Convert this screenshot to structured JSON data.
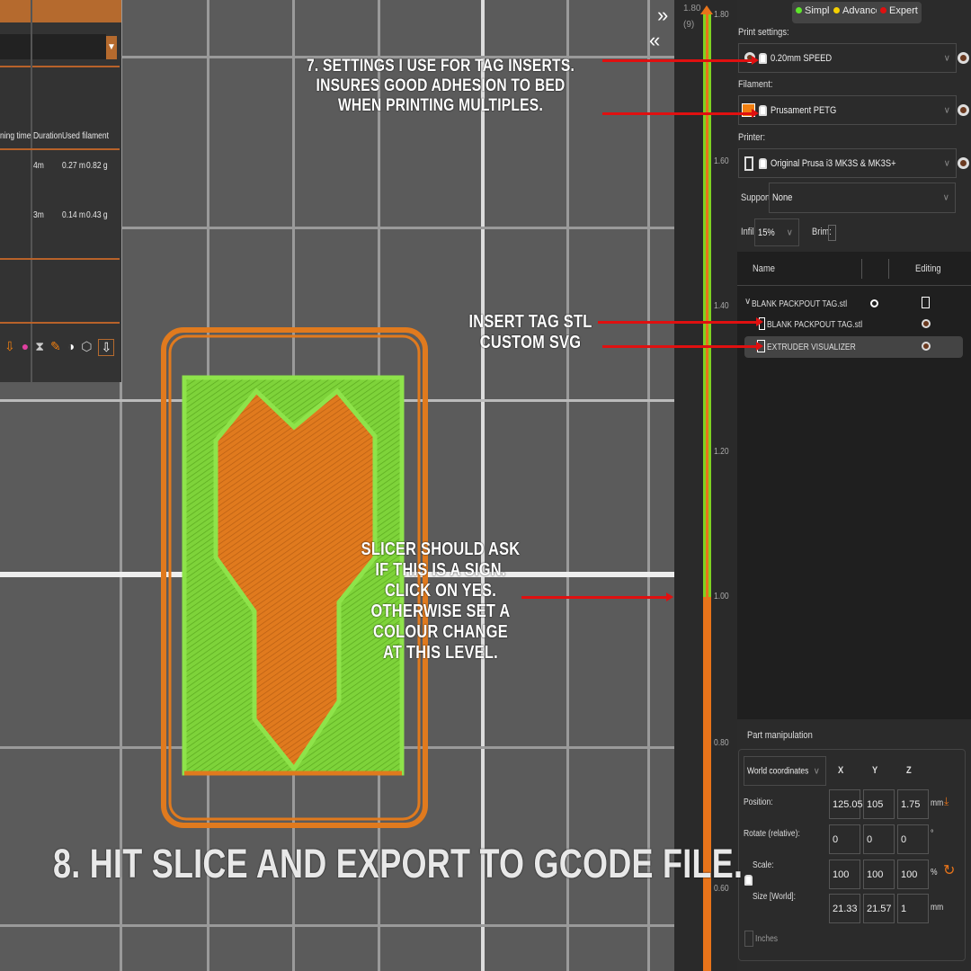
{
  "left_panel": {
    "columns": [
      "ning time",
      "Duration",
      "Used filament"
    ],
    "rows": [
      {
        "duration": "4m",
        "length": "0.27 m",
        "weight": "0.82 g"
      },
      {
        "duration": "3m",
        "length": "0.14 m",
        "weight": "0.43 g"
      }
    ],
    "toolbar_icons": [
      "extruder-icon",
      "color-icon",
      "hourglass-icon",
      "tool-change-icon",
      "center-icon",
      "wipe-tower-icon",
      "extruder-selected-icon"
    ]
  },
  "slider": {
    "top_label": "1.80",
    "top_layer": "(9)",
    "ticks": [
      "1.80",
      "1.60",
      "1.40",
      "1.20",
      "1.00",
      "0.80",
      "0.60"
    ],
    "colors": {
      "upper": "#7ed321",
      "lower": "#e8741a"
    }
  },
  "modes": [
    {
      "label": "Simple",
      "color": "#5ee62b"
    },
    {
      "label": "Advanced",
      "color": "#f5d000"
    },
    {
      "label": "Expert",
      "color": "#e01010"
    }
  ],
  "print_settings": {
    "label": "Print settings:",
    "value": "0.20mm SPEED"
  },
  "filament": {
    "label": "Filament:",
    "value": "Prusament PETG",
    "color": "#f07f10"
  },
  "printer": {
    "label": "Printer:",
    "value": "Original Prusa i3 MK3S & MK3S+"
  },
  "supports": {
    "label": "Supports:",
    "value": "None"
  },
  "infill": {
    "label": "Infill:",
    "value": "15%"
  },
  "brim": {
    "label": "Brim:"
  },
  "object_list": {
    "headers": [
      "Name",
      "Editing"
    ],
    "items": [
      {
        "name": "BLANK  PACKPOUT TAG.stl"
      },
      {
        "name": "BLANK  PACKPOUT TAG.stl"
      },
      {
        "name": "EXTRUDER VISUALIZER"
      }
    ]
  },
  "part_manipulation": {
    "title": "Part manipulation",
    "coords": "World coordinates",
    "axes": [
      "X",
      "Y",
      "Z"
    ],
    "position": {
      "label": "Position:",
      "values": [
        "125.05",
        "105",
        "1.75"
      ],
      "unit": "mm"
    },
    "rotate": {
      "label": "Rotate (relative):",
      "values": [
        "0",
        "0",
        "0"
      ],
      "unit": "°"
    },
    "scale": {
      "label": "Scale:",
      "values": [
        "100",
        "100",
        "100"
      ],
      "unit": "%"
    },
    "size": {
      "label": "Size [World]:",
      "values": [
        "21.33",
        "21.57",
        "1"
      ],
      "unit": "mm"
    },
    "inches": "Inches"
  },
  "annotations": {
    "settings": "7. SETTINGS I USE FOR TAG INSERTS.\nINSURES GOOD ADHESION TO BED\nWHEN PRINTING MULTIPLES.",
    "insert": "INSERT TAG STL\nCUSTOM SVG",
    "slicer": "SLICER SHOULD ASK\nIF THIS IS A SIGN.\nCLICK ON YES.\nOTHERWISE SET A\nCOLOUR CHANGE\nAT THIS LEVEL.",
    "slice": "8. HIT SLICE AND EXPORT TO GCODE FILE."
  }
}
